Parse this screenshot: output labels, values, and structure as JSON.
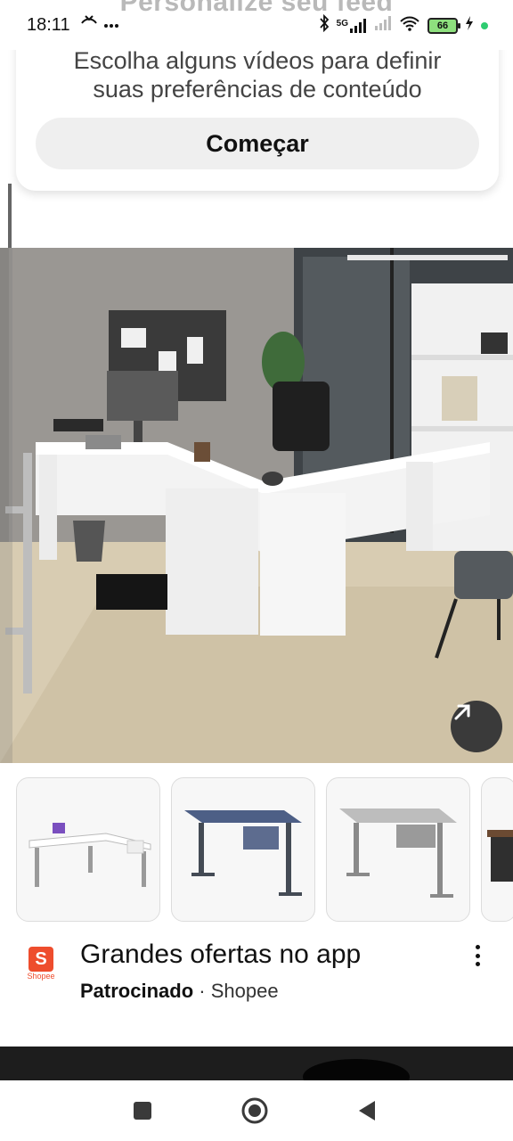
{
  "status_bar": {
    "time": "18:11",
    "left_icons": [
      "missed-call-icon",
      "more-dots-icon"
    ],
    "right_icons": [
      "bluetooth-icon",
      "signal-5g-icon",
      "signal-icon",
      "wifi-icon"
    ],
    "network": "5G",
    "battery_level": "66",
    "charging": true
  },
  "header": {
    "title": "Personalize seu feed"
  },
  "personalize_card": {
    "subtitle_line1": "Escolha alguns vídeos para definir",
    "subtitle_line2": "suas preferências de conteúdo",
    "button_label": "Começar"
  },
  "hero": {
    "image_name": "office-l-desk-photo",
    "expand_icon": "arrow-up-right-icon"
  },
  "thumbnails": [
    {
      "name": "white-l-desk-thumb"
    },
    {
      "name": "blue-desk-thumb"
    },
    {
      "name": "gray-desk-thumb"
    },
    {
      "name": "dark-desk-thumb"
    }
  ],
  "ad": {
    "logo_label": "Shopee",
    "title": "Grandes ofertas no app",
    "sponsored": "Patrocinado",
    "separator": " · ",
    "advertiser": "Shopee",
    "more_icon": "more-vertical-icon",
    "brand_color": "#ee4d2d"
  },
  "nav": {
    "icons": [
      "recents-square-icon",
      "home-circle-icon",
      "back-triangle-icon"
    ]
  }
}
